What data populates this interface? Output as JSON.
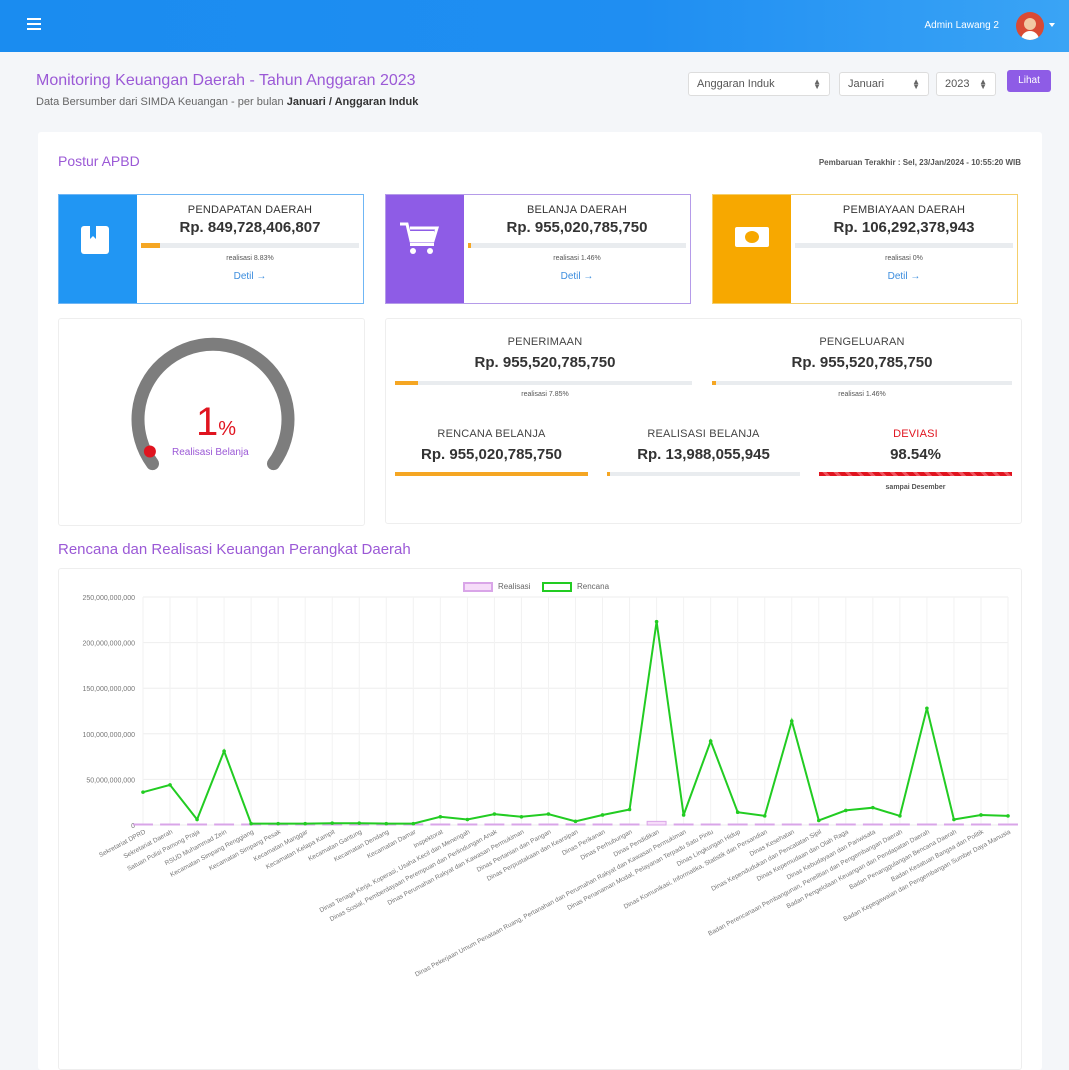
{
  "header": {
    "user_name": "Admin Lawang 2"
  },
  "page": {
    "title": "Monitoring Keuangan Daerah - Tahun Anggaran 2023",
    "subtitle_prefix": "Data Bersumber dari SIMDA Keuangan - per bulan ",
    "subtitle_bold": "Januari / Anggaran Induk"
  },
  "filters": {
    "anggaran": "Anggaran Induk",
    "bulan": "Januari",
    "tahun": "2023",
    "submit_label": "Lihat"
  },
  "postur": {
    "title": "Postur APBD",
    "last_update": "Pembaruan Terakhir : Sel, 23/Jan/2024 - 10:55:20 WIB"
  },
  "cards": [
    {
      "label": "PENDAPATAN DAERAH",
      "value": "Rp. 849,728,406,807",
      "realisasi": "realisasi 8.83%",
      "progress": 8.83,
      "detail": "Detil →",
      "color": "#2196f3",
      "icon": "book-icon"
    },
    {
      "label": "BELANJA DAERAH",
      "value": "Rp. 955,020,785,750",
      "realisasi": "realisasi 1.46%",
      "progress": 1.46,
      "detail": "Detil →",
      "color": "#8e5ce6",
      "icon": "cart-icon"
    },
    {
      "label": "PEMBIAYAAN DAERAH",
      "value": "Rp. 106,292,378,943",
      "realisasi": "realisasi 0%",
      "progress": 0,
      "detail": "Detil →",
      "color": "#f7a800",
      "icon": "money-icon"
    }
  ],
  "gauge": {
    "value": "1",
    "unit": "%",
    "label": "Realisasi Belanja",
    "fraction": 0.0146
  },
  "summary": {
    "penerimaan": {
      "label": "PENERIMAAN",
      "value": "Rp. 955,520,785,750",
      "realisasi": "realisasi 7.85%",
      "progress": 7.85
    },
    "pengeluaran": {
      "label": "PENGELUARAN",
      "value": "Rp. 955,520,785,750",
      "realisasi": "realisasi 1.46%",
      "progress": 1.46
    },
    "rencana": {
      "label": "RENCANA BELANJA",
      "value": "Rp. 955,020,785,750",
      "progress": 100
    },
    "realisasi": {
      "label": "REALISASI BELANJA",
      "value": "Rp. 13,988,055,945",
      "progress": 1.46
    },
    "deviasi": {
      "label": "DEVIASI",
      "value": "98.54%",
      "note": "sampai Desember",
      "progress": 100
    }
  },
  "chart_data": {
    "type": "line",
    "title": "Rencana dan Realisasi Keuangan Perangkat Daerah",
    "ylim": [
      0,
      250000000000
    ],
    "yticks": [
      "0",
      "50,000,000,000",
      "100,000,000,000",
      "150,000,000,000",
      "200,000,000,000",
      "250,000,000,000"
    ],
    "grid": true,
    "legend_position": "top",
    "categories": [
      "Sekretariat DPRD",
      "Sekretariat Daerah",
      "Satuan Polisi Pamong Praja",
      "RSUD Muhammad Zein",
      "Kecamatan Simpang Renggiang",
      "Kecamatan Simpang Pesak",
      "Kecamatan Manggar",
      "Kecamatan Kelapa Kampit",
      "Kecamatan Gantung",
      "Kecamatan Dendang",
      "Kecamatan Damar",
      "Inspektorat",
      "Dinas Tenaga Kerja, Koperasi, Usaha Kecil dan Menengah",
      "Dinas Sosial, Pemberdayaan Perempuan dan Perlindungan Anak",
      "Dinas Perumahan Rakyat dan Kawasan Permukiman",
      "Dinas Pertanian dan Pangan",
      "Dinas Perpustakaan dan Kearsipan",
      "Dinas Perikanan",
      "Dinas Perhubungan",
      "Dinas Pendidikan",
      "Dinas Pekerjaan Umum Penataan Ruang, Pertanahan dan Perumahan Rakyat dan Kawasan Permukiman",
      "Dinas Penanaman Modal, Pelayanan Terpadu Satu Pintu",
      "Dinas Lingkungan Hidup",
      "Dinas Komunikasi, Informatika, Statistik dan Persandian",
      "Dinas Kesehatan",
      "Dinas Kependudukan dan Pencatatan Sipil",
      "Dinas Kepemudaan dan Olah Raga",
      "Dinas Kebudayaan dan Pariwisata",
      "Badan Perencanaan Pembangunan, Penelitian dan Pengembangan Daerah",
      "Badan Pengelolaan Keuangan dan Pendapatan Daerah",
      "Badan Penanggulangan Bencana Daerah",
      "Badan Kesatuan Bangsa dan Politik",
      "Badan Kepegawaian dan Pengembangan Sumber Daya Manusia"
    ],
    "series": [
      {
        "name": "Realisasi",
        "color": "#e9b8f0",
        "type": "bar",
        "values": [
          500000000,
          500000000,
          300000000,
          800000000,
          100000000,
          100000000,
          100000000,
          100000000,
          100000000,
          100000000,
          100000000,
          200000000,
          200000000,
          300000000,
          300000000,
          300000000,
          200000000,
          300000000,
          500000000,
          4000000000,
          400000000,
          300000000,
          300000000,
          300000000,
          800000000,
          300000000,
          400000000,
          400000000,
          400000000,
          400000000,
          200000000,
          200000000,
          400000000
        ]
      },
      {
        "name": "Rencana",
        "color": "#22cc22",
        "type": "line",
        "values": [
          36000000000,
          44000000000,
          6000000000,
          81000000000,
          1500000000,
          1500000000,
          1500000000,
          2000000000,
          2000000000,
          1500000000,
          1500000000,
          9000000000,
          6000000000,
          12000000000,
          9000000000,
          12000000000,
          4000000000,
          11000000000,
          17000000000,
          223000000000,
          11000000000,
          92000000000,
          14000000000,
          10000000000,
          114000000000,
          5000000000,
          16000000000,
          19000000000,
          10000000000,
          128000000000,
          6000000000,
          11000000000,
          10000000000
        ]
      }
    ]
  }
}
